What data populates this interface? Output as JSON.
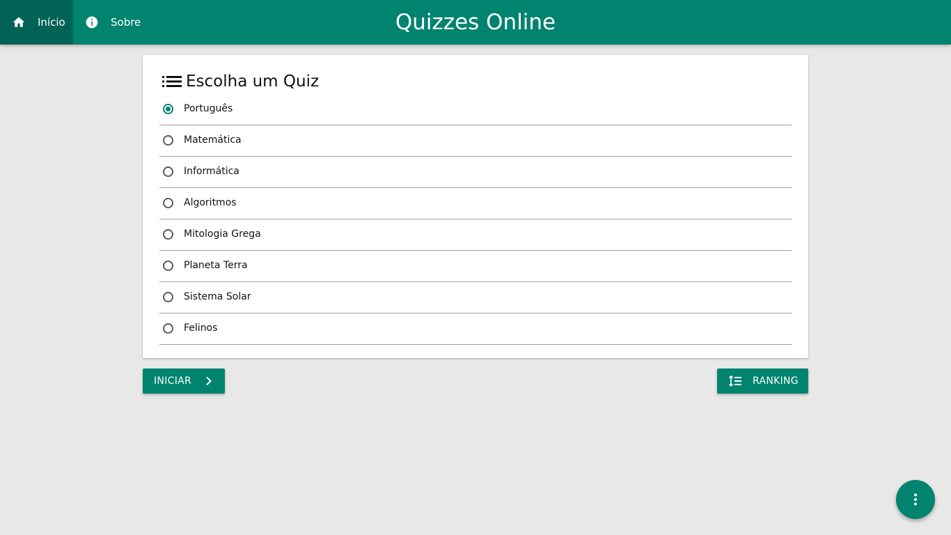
{
  "nav": {
    "home_label": "Início",
    "home_icon": "home-icon",
    "about_label": "Sobre",
    "about_icon": "info-icon"
  },
  "header": {
    "title": "Quizzes Online"
  },
  "quiz_card": {
    "title": "Escolha um Quiz",
    "title_icon": "list-icon",
    "selected": "Português",
    "options": [
      {
        "label": "Português",
        "checked": true
      },
      {
        "label": "Matemática",
        "checked": false
      },
      {
        "label": "Informática",
        "checked": false
      },
      {
        "label": "Algoritmos",
        "checked": false
      },
      {
        "label": "Mitologia Grega",
        "checked": false
      },
      {
        "label": "Planeta Terra",
        "checked": false
      },
      {
        "label": "Sistema Solar",
        "checked": false
      },
      {
        "label": "Felinos",
        "checked": false
      }
    ]
  },
  "actions": {
    "start_label": "INICIAR",
    "start_icon": "chevron-right-icon",
    "ranking_label": "RANKING",
    "ranking_icon": "sort-list-icon"
  },
  "fab": {
    "icon": "more-vertical-icon"
  },
  "colors": {
    "primary": "#00836f",
    "primary_dark": "#006356",
    "background": "#e8e8e8"
  }
}
